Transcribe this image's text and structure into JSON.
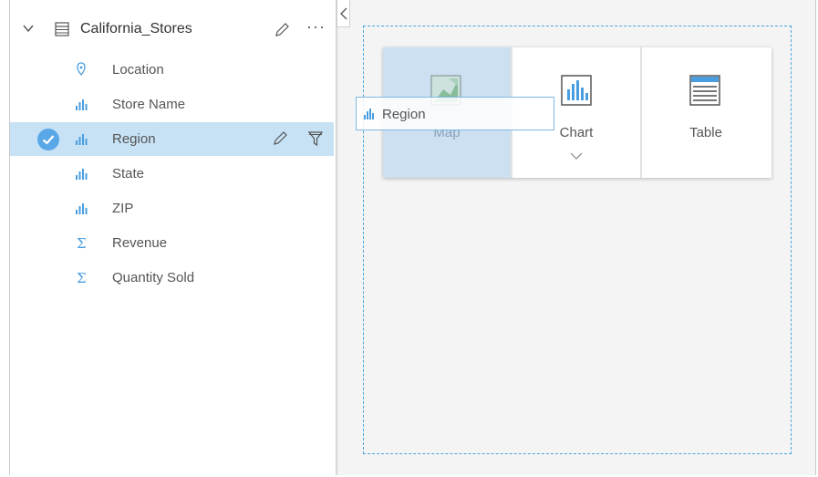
{
  "data_pane": {
    "dataset_name": "California_Stores",
    "more_label": "···",
    "fields": [
      {
        "label": "Location",
        "icon": "location-icon",
        "selected": false
      },
      {
        "label": "Store Name",
        "icon": "string-field-icon",
        "selected": false
      },
      {
        "label": "Region",
        "icon": "string-field-icon",
        "selected": true
      },
      {
        "label": "State",
        "icon": "string-field-icon",
        "selected": false
      },
      {
        "label": "ZIP",
        "icon": "string-field-icon",
        "selected": false
      },
      {
        "label": "Revenue",
        "icon": "number-field-icon",
        "selected": false
      },
      {
        "label": "Quantity Sold",
        "icon": "number-field-icon",
        "selected": false
      }
    ]
  },
  "canvas": {
    "viz_options": [
      {
        "label": "Map",
        "icon": "map-icon",
        "active": true
      },
      {
        "label": "Chart",
        "icon": "chart-icon",
        "active": false
      },
      {
        "label": "Table",
        "icon": "table-icon",
        "active": false
      }
    ],
    "drag_chip": {
      "label": "Region",
      "icon": "string-field-icon"
    }
  },
  "colors": {
    "accent": "#5aa7e8",
    "selected_row": "#c7e2f5",
    "drop_zone_border": "#4aa3df",
    "string_icon": "#4a9ee0",
    "number_icon": "#4a9ee0"
  }
}
